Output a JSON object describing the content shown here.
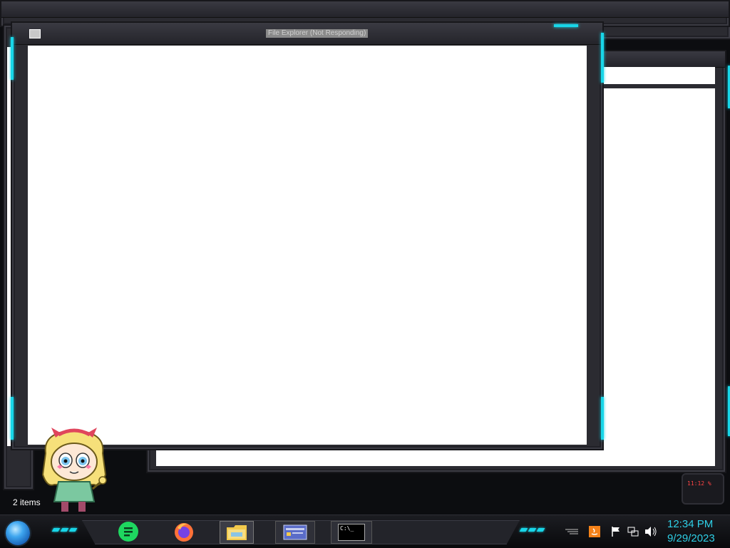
{
  "main_window": {
    "title": "File Explorer (Not Responding)"
  },
  "explorer_status": {
    "item_count": "2 items"
  },
  "taskbar": {
    "pinned": [
      {
        "name": "Notes",
        "icon": "notes-app-icon"
      },
      {
        "name": "Firefox",
        "icon": "firefox-icon"
      },
      {
        "name": "File Explorer",
        "icon": "folder-icon"
      },
      {
        "name": "Control Panel",
        "icon": "window-card-icon"
      },
      {
        "name": "Command Prompt",
        "icon": "terminal-icon",
        "label": "C:\\_"
      }
    ],
    "tray_icons": [
      "java-icon",
      "flag-icon",
      "network-icon",
      "volume-icon"
    ],
    "clock": {
      "time": "12:34 PM",
      "date": "9/29/2023"
    }
  },
  "gadget": {
    "readout": "11:12 %"
  },
  "colors": {
    "accent": "#18d6e8",
    "clock": "#2ecfe6",
    "frame": "#2b2b31",
    "client": "#ffffff"
  }
}
